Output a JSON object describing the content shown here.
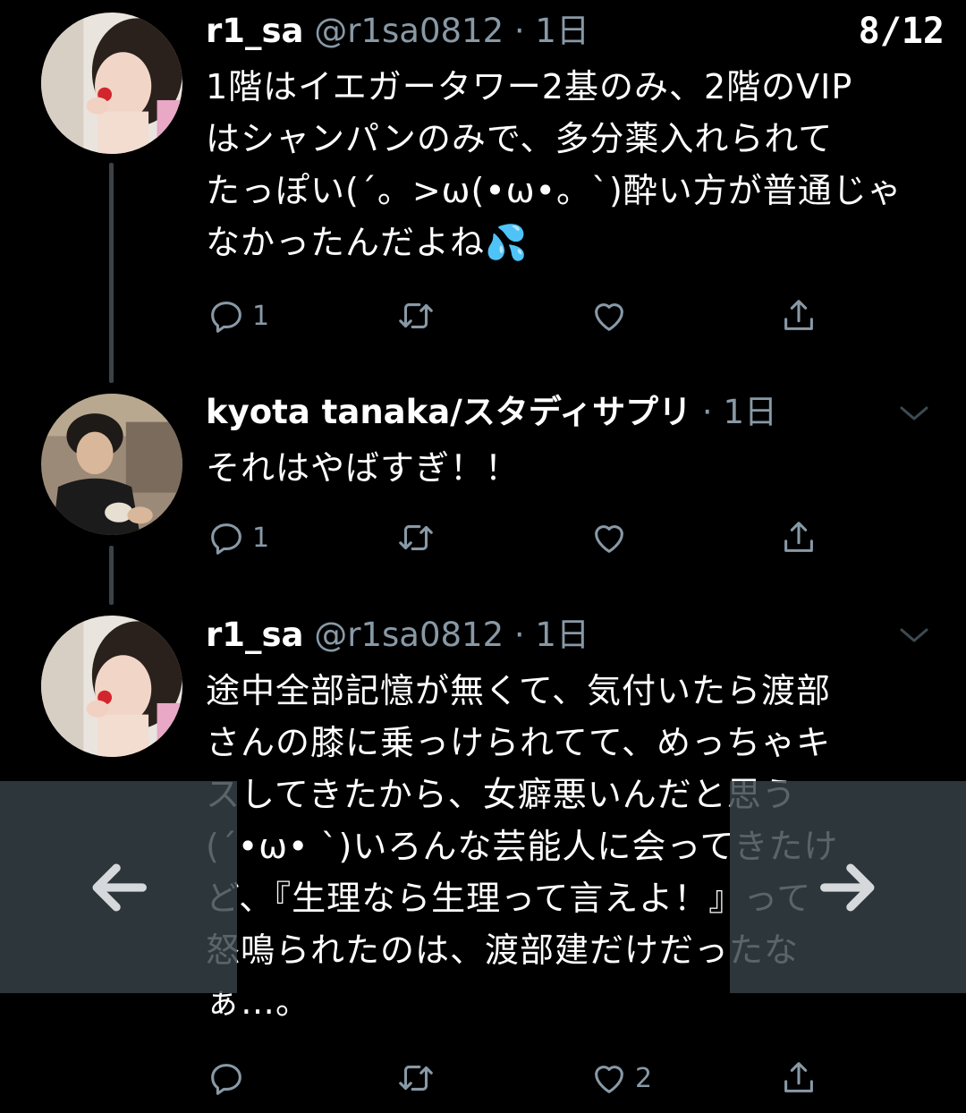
{
  "viewer": {
    "page_counter": "8/12"
  },
  "tweets": [
    {
      "display_name": "r1_sa",
      "handle": "@r1sa0812",
      "separator": "·",
      "time": "1日",
      "text": "1階はイエガータワー2基のみ、2階のVIP\nはシャンパンのみで、多分薬入れられて\nたっぽい(´。>ω(•ω•。`)酔い方が普通じゃ\nなかったんだよね💦",
      "reply_count": "1",
      "like_count": ""
    },
    {
      "display_name": "kyota tanaka/スタディサプリ",
      "handle": "",
      "separator": "·",
      "time": "1日",
      "text": "それはやばすぎ！！",
      "reply_count": "1",
      "like_count": ""
    },
    {
      "display_name": "r1_sa",
      "handle": "@r1sa0812",
      "separator": "·",
      "time": "1日",
      "text": "途中全部記憶が無くて、気付いたら渡部\nさんの膝に乗っけられてて、めっちゃキ\nスしてきたから、女癖悪いんだと思う\n(´•ω• `)いろんな芸能人に会ってきたけ\nど、『生理なら生理って言えよ！』って\n怒鳴られたのは、渡部建だけだったな\nぁ…。",
      "reply_count": "",
      "like_count": "2"
    }
  ],
  "colors": {
    "background": "#000000",
    "text_primary": "#ffffff",
    "text_secondary": "#8899a6",
    "thread_line": "#3d4246",
    "nav_overlay": "#374248"
  },
  "icons": {
    "reply": "reply-icon",
    "retweet": "retweet-icon",
    "like": "heart-icon",
    "share": "share-icon",
    "more": "chevron-down-icon",
    "prev": "arrow-left-icon",
    "next": "arrow-right-icon"
  }
}
